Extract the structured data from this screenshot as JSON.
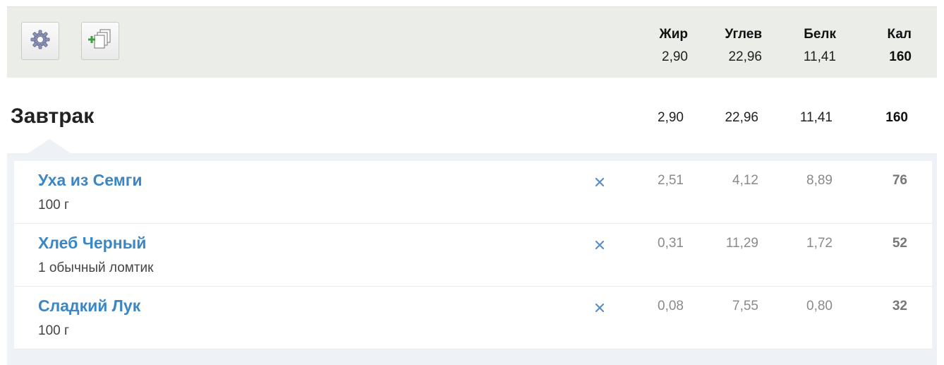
{
  "summary": {
    "headers": {
      "fat": "Жир",
      "carbs": "Углев",
      "protein": "Белк",
      "cal": "Кал"
    },
    "totals": {
      "fat": "2,90",
      "carbs": "22,96",
      "protein": "11,41",
      "cal": "160"
    }
  },
  "meal": {
    "title": "Завтрак",
    "totals": {
      "fat": "2,90",
      "carbs": "22,96",
      "protein": "11,41",
      "cal": "160"
    },
    "entries": [
      {
        "name": "Уха из Семги",
        "portion": "100 г",
        "fat": "2,51",
        "carbs": "4,12",
        "protein": "8,89",
        "cal": "76"
      },
      {
        "name": "Хлеб Черный",
        "portion": "1 обычный ломтик",
        "fat": "0,31",
        "carbs": "11,29",
        "protein": "1,72",
        "cal": "52"
      },
      {
        "name": "Сладкий Лук",
        "portion": "100 г",
        "fat": "0,08",
        "carbs": "7,55",
        "protein": "0,80",
        "cal": "32"
      }
    ]
  },
  "icons": {
    "settings": "gear-icon",
    "add": "add-copy-icon",
    "delete": "delete-x-icon"
  },
  "colors": {
    "link": "#3b86c4",
    "bar": "#ebede9",
    "panel": "#eef2f7"
  }
}
